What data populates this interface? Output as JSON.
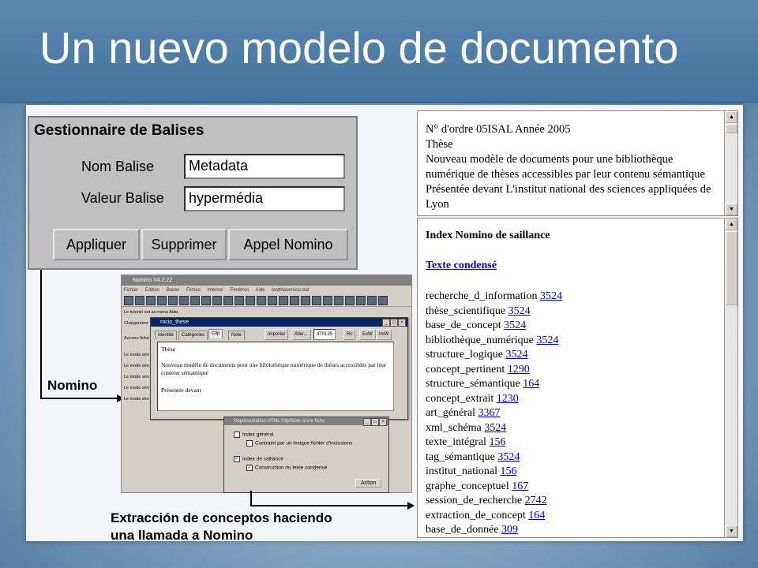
{
  "slide": {
    "title": "Un nuevo modelo de documento"
  },
  "balises": {
    "heading": "Gestionnaire de Balises",
    "name_label": "Nom Balise",
    "name_value": "Metadata",
    "value_label": "Valeur Balise",
    "value_value": "hypermédia",
    "buttons": [
      "Appliquer",
      "Supprimer",
      "Appel Nomino"
    ]
  },
  "captions": {
    "nomino": "Nomino",
    "extraction_1": "Extracción de conceptos haciendo",
    "extraction_2": "una llamada a Nomino"
  },
  "nomino_window": {
    "title": "Nomino V4.2.22",
    "menu": [
      "Fichier",
      "Edition",
      "Bases",
      "Fiches",
      "Internet",
      "Fenêtres",
      "Aide",
      "testtheserocio.baf"
    ],
    "lines": [
      "Le tutoriel est au menu Aide.",
      "Chargement",
      "Aucune fiche",
      "Le mode sén",
      "Le mode sén",
      "Le mode sén",
      "Le mode sén",
      "Le mode sén"
    ]
  },
  "rocio_window": {
    "title": "rocio_these",
    "tabs": [
      "Identité",
      "Catégories",
      "Clip",
      "Note"
    ],
    "buttons": [
      "Importer",
      "Aller...",
      "Rc",
      "ExW",
      "ImW"
    ],
    "field": "470135",
    "text": [
      "Thèse",
      "Nouveau modèle de documents pour une bibliothèque numérique de thèses accessibles par leur contenu sémantique",
      "Présentée devant"
    ]
  },
  "repr_window": {
    "title": "Représentation HTML Clip/Note d'une fiche",
    "options": [
      {
        "label": "Index général",
        "checked": false
      },
      {
        "label": "Contraint par un lexique fichier d'inclusions",
        "checked": false
      },
      {
        "label": "Index de saillance",
        "checked": true
      },
      {
        "label": "Construction du texte condensé",
        "checked": true
      }
    ],
    "action": "Action"
  },
  "top_pane": {
    "lines": [
      "N° d'ordre 05ISAL Année 2005",
      "Thèse",
      "Nouveau modèle de documents pour une bibliothèque",
      "numérique de thèses accessibles par leur contenu sémantique",
      "Présentée devant L'institut national des sciences appliquées de",
      "Lyon"
    ]
  },
  "index_pane": {
    "title": "Index Nomino de saillance",
    "link": "Texte condensé",
    "terms": [
      {
        "term": "recherche_d_information",
        "value": "3524"
      },
      {
        "term": "thèse_scientifique",
        "value": "3524"
      },
      {
        "term": "base_de_concept",
        "value": "3524"
      },
      {
        "term": "bibliothèque_numérique",
        "value": "3524"
      },
      {
        "term": "structure_logique",
        "value": "3524"
      },
      {
        "term": "concept_pertinent",
        "value": "1290"
      },
      {
        "term": "structure_sémantique",
        "value": "164"
      },
      {
        "term": "concept_extrait",
        "value": "1230"
      },
      {
        "term": "art_général",
        "value": "3367"
      },
      {
        "term": "xml_schéma",
        "value": "3524"
      },
      {
        "term": "texte_intégral",
        "value": "156"
      },
      {
        "term": "tag_sémantique",
        "value": "3524"
      },
      {
        "term": "institut_national",
        "value": "156"
      },
      {
        "term": "graphe_conceptuel",
        "value": "167"
      },
      {
        "term": "session_de_recherche",
        "value": "2742"
      },
      {
        "term": "extraction_de_concept",
        "value": "164"
      },
      {
        "term": "base_de_donnée",
        "value": "309"
      }
    ]
  }
}
